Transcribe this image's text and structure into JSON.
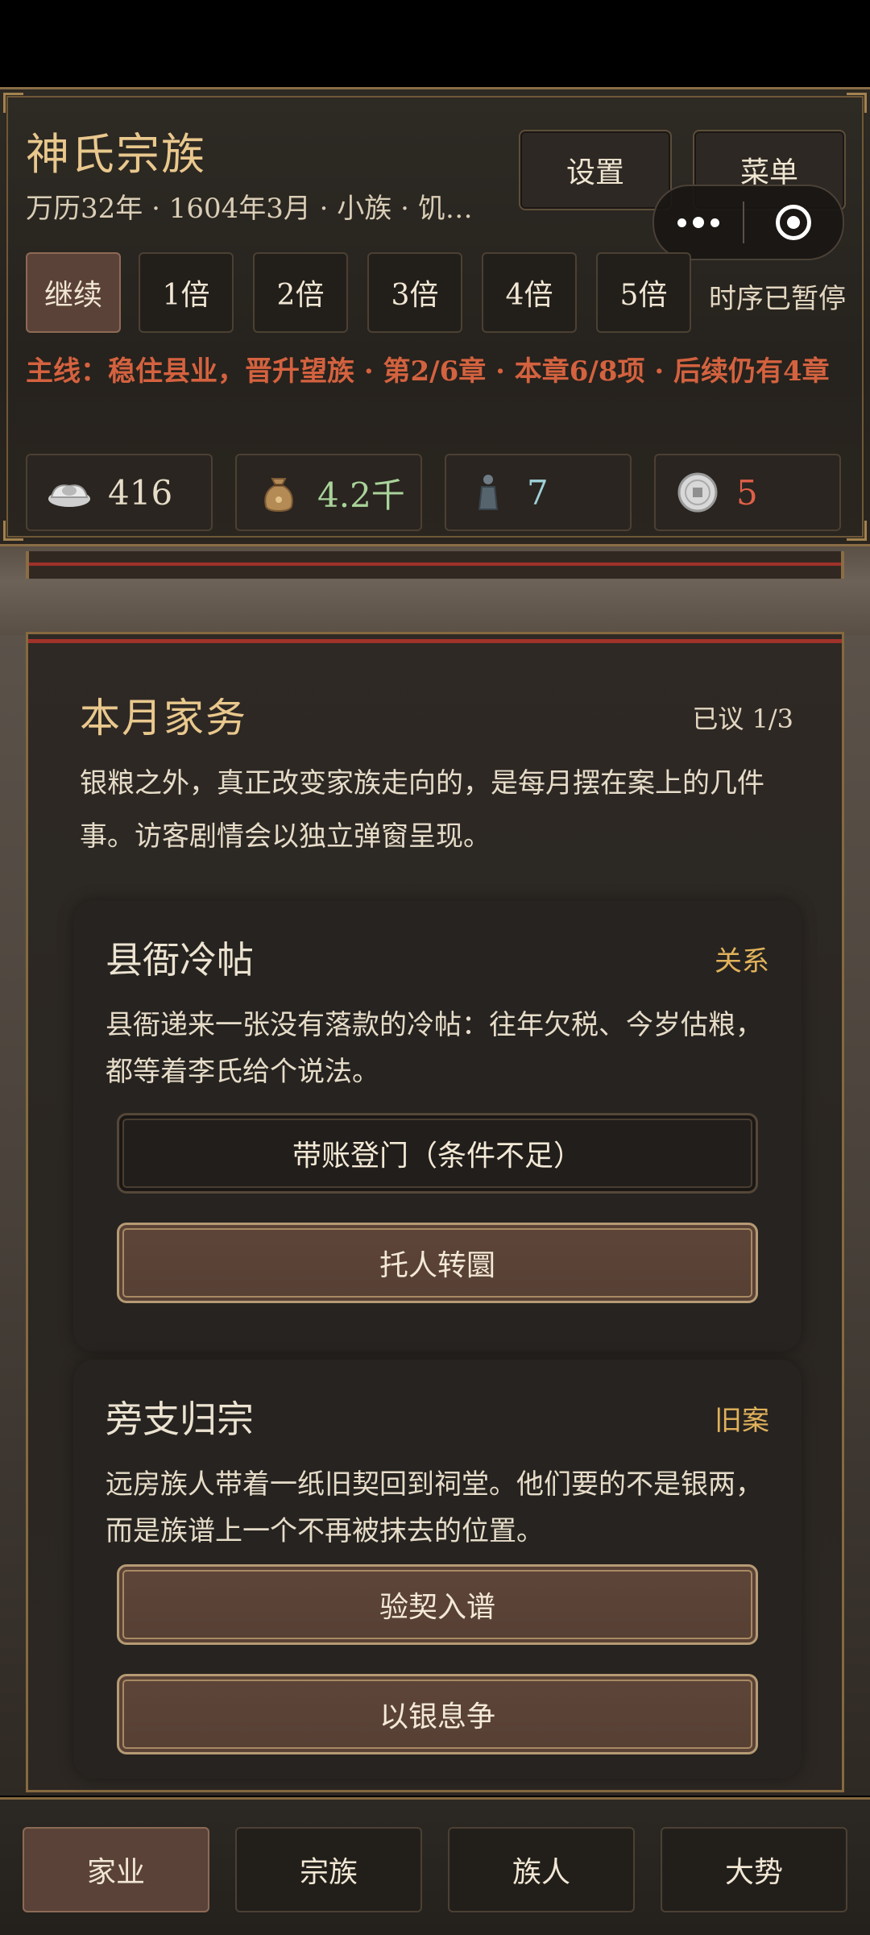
{
  "header": {
    "title": "神氏宗族",
    "subtitle": "万历32年 · 1604年3月 · 小族 · 饥…",
    "settings_label": "设置",
    "menu_label": "菜单",
    "speeds": [
      "继续",
      "1倍",
      "2倍",
      "3倍",
      "4倍",
      "5倍"
    ],
    "paused_text": "时序已暂停",
    "mainline": "主线：稳住县业，晋升望族 · 第2/6章 · 本章6/8项 · 后续仍有4章",
    "resources": [
      {
        "icon": "silver-ingot-icon",
        "value": "416",
        "color": "#e6dcc8"
      },
      {
        "icon": "grain-sack-icon",
        "value": "4.2千",
        "color": "#a9d39a"
      },
      {
        "icon": "person-figure-icon",
        "value": "7",
        "color": "#9fd0d7"
      },
      {
        "icon": "coin-icon",
        "value": "5",
        "color": "#e05f48"
      }
    ]
  },
  "panel": {
    "title": "本月家务",
    "progress": "已议 1/3",
    "intro": "银粮之外，真正改变家族走向的，是每月摆在案上的几件事。访客剧情会以独立弹窗呈现。"
  },
  "cards": [
    {
      "title": "县衙冷帖",
      "tag": "关系",
      "text": "县衙递来一张没有落款的冷帖：往年欠税、今岁估粮，都等着李氏给个说法。",
      "actions": [
        {
          "label": "带账登门（条件不足）",
          "enabled": false
        },
        {
          "label": "托人转圜",
          "enabled": true
        }
      ]
    },
    {
      "title": "旁支归宗",
      "tag": "旧案",
      "text": "远房族人带着一纸旧契回到祠堂。他们要的不是银两，而是族谱上一个不再被抹去的位置。",
      "actions": [
        {
          "label": "验契入谱",
          "enabled": true
        },
        {
          "label": "以银息争",
          "enabled": true
        }
      ]
    }
  ],
  "bottom_nav": [
    "家业",
    "宗族",
    "族人",
    "大势"
  ]
}
